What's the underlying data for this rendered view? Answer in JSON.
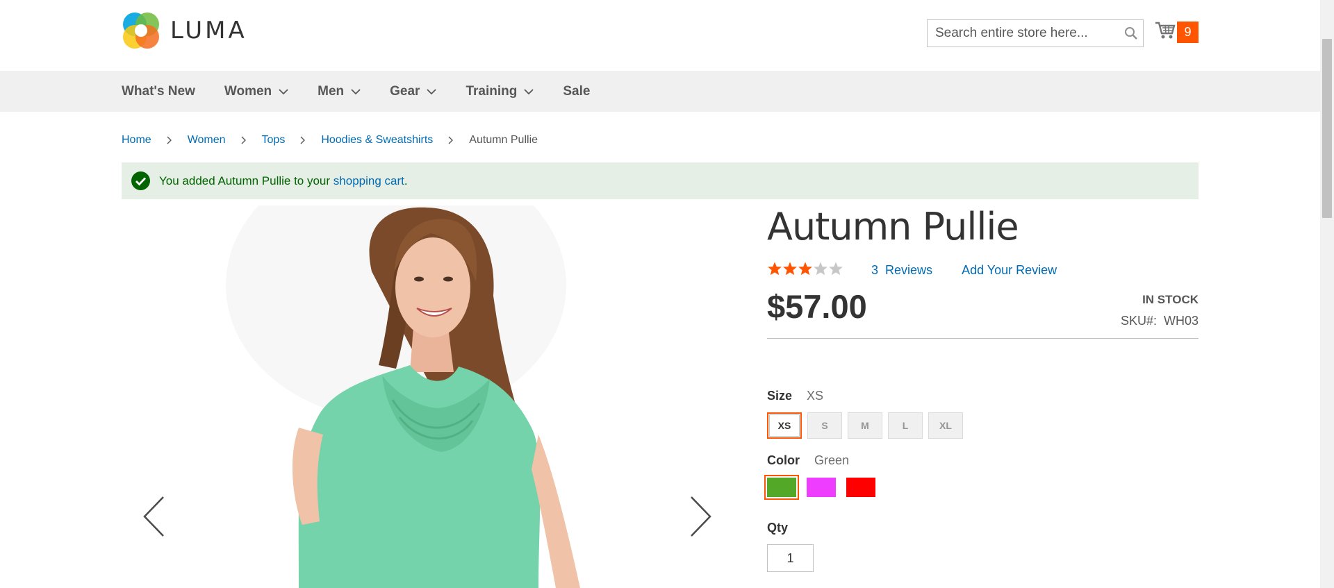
{
  "header": {
    "logo_text": "LUMA",
    "search": {
      "placeholder": "Search entire store here..."
    },
    "cart": {
      "count": "9"
    }
  },
  "nav": {
    "items": [
      {
        "label": "What's New",
        "has_dropdown": false
      },
      {
        "label": "Women",
        "has_dropdown": true
      },
      {
        "label": "Men",
        "has_dropdown": true
      },
      {
        "label": "Gear",
        "has_dropdown": true
      },
      {
        "label": "Training",
        "has_dropdown": true
      },
      {
        "label": "Sale",
        "has_dropdown": false
      }
    ]
  },
  "breadcrumb": {
    "items": [
      "Home",
      "Women",
      "Tops",
      "Hoodies & Sweatshirts"
    ],
    "current": "Autumn Pullie"
  },
  "message": {
    "prefix": "You added Autumn Pullie to your ",
    "link": "shopping cart",
    "suffix": "."
  },
  "product": {
    "name": "Autumn Pullie",
    "rating": 3,
    "rating_max": 5,
    "reviews_count": "3",
    "reviews_label": "Reviews",
    "add_review": "Add Your Review",
    "price": "$57.00",
    "stock": "IN STOCK",
    "sku_label": "SKU#:",
    "sku": "WH03",
    "size": {
      "label": "Size",
      "selected": "XS",
      "options": [
        "XS",
        "S",
        "M",
        "L",
        "XL"
      ]
    },
    "color": {
      "label": "Color",
      "selected": "Green",
      "swatches": [
        {
          "name": "Green",
          "hex": "#53a828"
        },
        {
          "name": "Purple",
          "hex": "#ef3dff"
        },
        {
          "name": "Red",
          "hex": "#ff0000"
        }
      ]
    },
    "qty": {
      "label": "Qty",
      "value": "1"
    }
  },
  "colors": {
    "accent": "#ff5501",
    "link": "#006bb4",
    "success_bg": "#e5efe5",
    "success_text": "#006400",
    "nav_bg": "#f0f0f0"
  }
}
